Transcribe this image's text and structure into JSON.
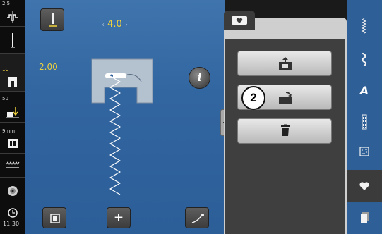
{
  "sidebar": {
    "items": [
      {
        "icon": "thread-tension-icon",
        "value": "2.5"
      },
      {
        "icon": "needle-position-icon",
        "value": ""
      },
      {
        "icon": "presser-foot-icon",
        "value": "1C"
      },
      {
        "icon": "presser-foot-pressure-icon",
        "value": "50"
      },
      {
        "icon": "feed-dog-height-icon",
        "value": "9mm"
      },
      {
        "icon": "stitch-plate-icon",
        "value": ""
      },
      {
        "icon": "bobbin-icon",
        "value": ""
      },
      {
        "icon": "clock-icon",
        "value": "11:30"
      }
    ]
  },
  "stitch": {
    "width_value": "4.0",
    "length_value": "2.00",
    "left_arrow": "‹",
    "right_arrow": "›",
    "info_label": "i"
  },
  "memory_panel": {
    "tab_icon": "heart-icon",
    "buttons": [
      {
        "icon": "save-to-folder-icon"
      },
      {
        "icon": "overwrite-folder-icon"
      },
      {
        "icon": "delete-trash-icon"
      }
    ],
    "callout_number": "2"
  },
  "categories": [
    {
      "icon": "practical-stitches-icon"
    },
    {
      "icon": "decorative-stitches-icon"
    },
    {
      "icon": "alphabets-icon",
      "label": "A"
    },
    {
      "icon": "buttonholes-icon"
    },
    {
      "icon": "quilt-stitches-icon"
    },
    {
      "icon": "personal-memory-icon",
      "selected": true
    },
    {
      "icon": "clipboard-icon"
    }
  ],
  "bottom_bar": {
    "buttons": [
      {
        "icon": "pattern-end-icon"
      },
      {
        "icon": "add-plus-icon",
        "label": "+"
      },
      {
        "icon": "thread-cutter-icon"
      }
    ]
  },
  "colors": {
    "main_bg": "#3266a0",
    "value_yellow": "#f0d23c",
    "panel_bg": "#3f3f3f",
    "panel_frame": "#cfcfcf"
  }
}
